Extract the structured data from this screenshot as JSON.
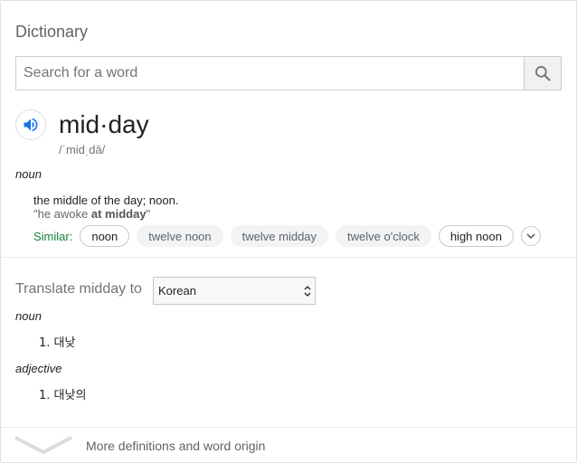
{
  "panel": {
    "title": "Dictionary"
  },
  "search": {
    "placeholder": "Search for a word",
    "value": ""
  },
  "entry": {
    "headword": "mid·day",
    "phonetic": "/ˈmidˌdā/",
    "pos": "noun",
    "definition": "the middle of the day; noon.",
    "example_before": "\"he awoke ",
    "example_bold": "at midday",
    "example_after": "\"",
    "similar_label": "Similar:",
    "similar": [
      "noon",
      "twelve noon",
      "twelve midday",
      "twelve o'clock",
      "high noon"
    ]
  },
  "translate": {
    "label": "Translate midday to",
    "language": "Korean",
    "sections": [
      {
        "pos": "noun",
        "items": [
          "1. 대낮"
        ]
      },
      {
        "pos": "adjective",
        "items": [
          "1. 대낮의"
        ]
      }
    ]
  },
  "footer": {
    "more_label": "More definitions and word origin"
  },
  "colors": {
    "accent_blue": "#1a73e8",
    "similar_green": "#188038",
    "muted_text": "#70757a",
    "chip_fill": "#f1f3f4",
    "border": "#dfe1e5"
  },
  "icons": {
    "search": "search-icon",
    "speaker": "speaker-icon",
    "expand": "chevron-down-icon",
    "more": "chevron-down-icon"
  }
}
